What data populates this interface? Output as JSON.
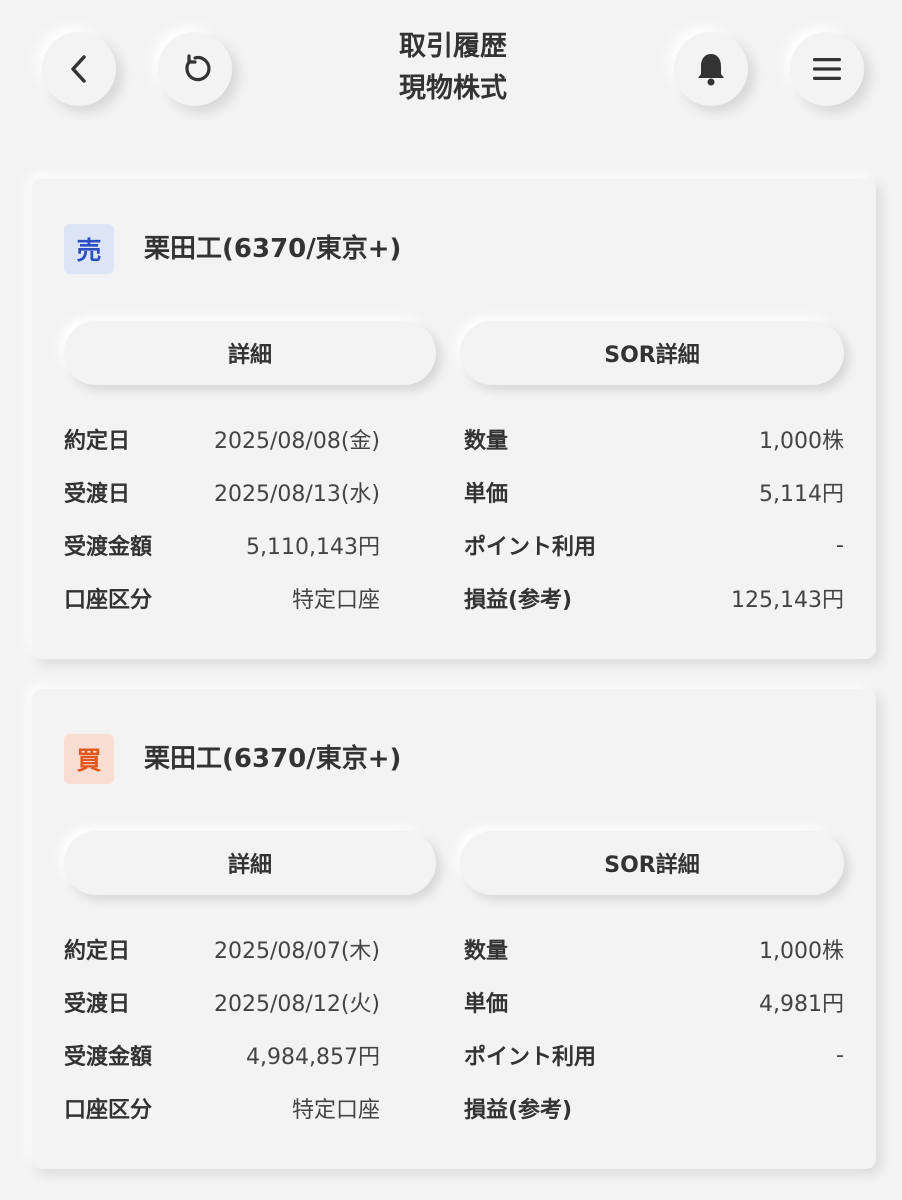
{
  "header": {
    "title_line1": "取引履歴",
    "title_line2": "現物株式",
    "icons": [
      "chevron-left-icon",
      "reload-icon",
      "bell-icon",
      "hamburger-menu-icon"
    ]
  },
  "cards": [
    {
      "badge": "売",
      "stock": "栗田工(6370/東京+)",
      "detail_label": "詳細",
      "sor_label": "SOR詳細",
      "left": [
        {
          "label": "約定日",
          "value": "2025/08/08(金)"
        },
        {
          "label": "受渡日",
          "value": "2025/08/13(水)"
        },
        {
          "label": "受渡金額",
          "value": "5,110,143円"
        },
        {
          "label": "口座区分",
          "value": "特定口座"
        }
      ],
      "right": [
        {
          "label": "数量",
          "value": "1,000株"
        },
        {
          "label": "単価",
          "value": "5,114円"
        },
        {
          "label": "ポイント利用",
          "value": "-"
        },
        {
          "label": "損益(参考)",
          "value": "125,143円"
        }
      ]
    },
    {
      "badge": "買",
      "stock": "栗田工(6370/東京+)",
      "detail_label": "詳細",
      "sor_label": "SOR詳細",
      "left": [
        {
          "label": "約定日",
          "value": "2025/08/07(木)"
        },
        {
          "label": "受渡日",
          "value": "2025/08/12(火)"
        },
        {
          "label": "受渡金額",
          "value": "4,984,857円"
        },
        {
          "label": "口座区分",
          "value": "特定口座"
        }
      ],
      "right": [
        {
          "label": "数量",
          "value": "1,000株"
        },
        {
          "label": "単価",
          "value": "4,981円"
        },
        {
          "label": "ポイント利用",
          "value": "-"
        },
        {
          "label": "損益(参考)",
          "value": ""
        }
      ]
    }
  ],
  "colors": {
    "background": "#f3f3f3",
    "sell_badge_bg": "#dde4f5",
    "sell_badge_text": "#2b4fc2",
    "buy_badge_bg": "#f8ddd2",
    "buy_badge_text": "#e0581e",
    "text": "#333333"
  }
}
